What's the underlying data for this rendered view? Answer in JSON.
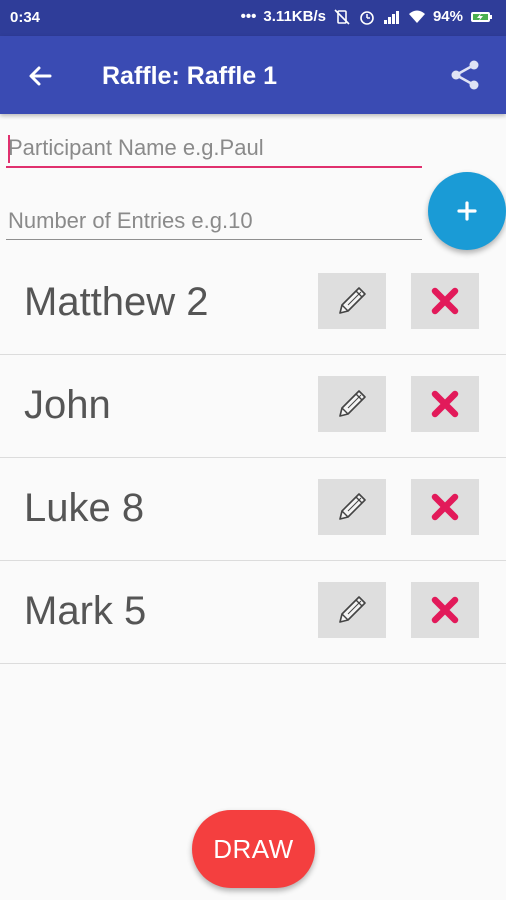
{
  "status": {
    "time": "0:34",
    "speed": "3.11KB/s",
    "battery": "94%"
  },
  "appbar": {
    "title": "Raffle: Raffle 1"
  },
  "form": {
    "name_placeholder": "Participant Name e.g.Paul",
    "entries_placeholder": "Number of Entries e.g.10"
  },
  "participants": [
    {
      "label": "Matthew 2"
    },
    {
      "label": "John"
    },
    {
      "label": "Luke 8"
    },
    {
      "label": "Mark 5"
    }
  ],
  "actions": {
    "draw_label": "DRAW"
  },
  "colors": {
    "appbar": "#3a4bb3",
    "statusbar": "#2f3d99",
    "accent": "#e0306e",
    "fab": "#1a9bd6",
    "draw": "#f43f3f",
    "delete_icon": "#e21a5a"
  },
  "icons": {
    "back": "arrow-back-icon",
    "share": "share-icon",
    "add": "plus-icon",
    "edit": "pencil-icon",
    "delete": "close-x-icon"
  }
}
